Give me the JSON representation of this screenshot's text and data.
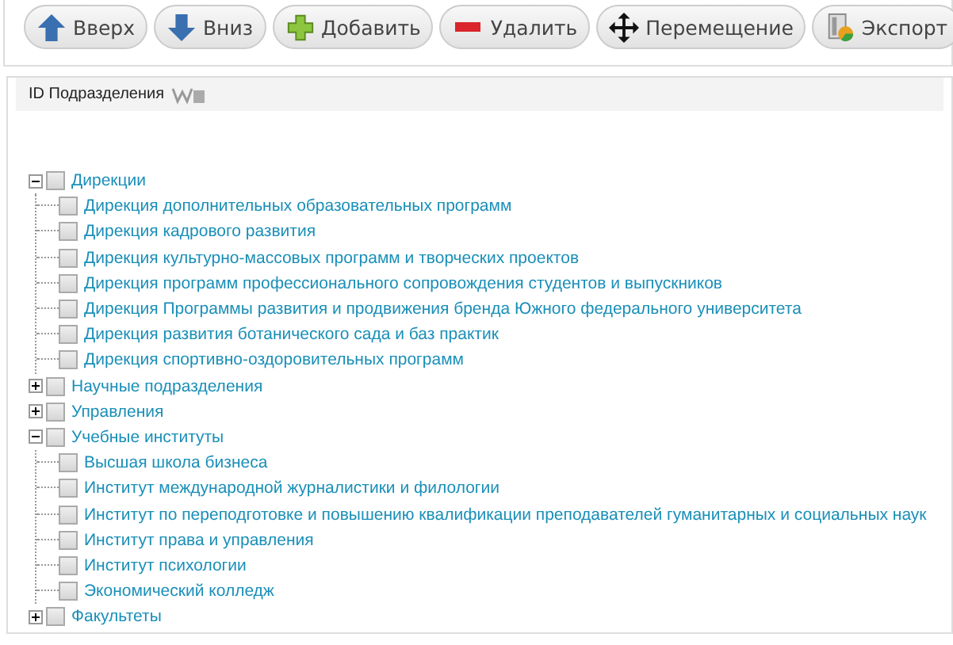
{
  "toolbar": {
    "buttons": [
      {
        "label": "Вверх",
        "kind": "up"
      },
      {
        "label": "Вниз",
        "kind": "down"
      },
      {
        "label": "Добавить",
        "kind": "add"
      },
      {
        "label": "Удалить",
        "kind": "delete"
      },
      {
        "label": "Перемещение",
        "kind": "move"
      },
      {
        "label": "Экспорт",
        "kind": "export"
      }
    ]
  },
  "tree_panel": {
    "header": "ID Подразделения",
    "nodes": [
      {
        "label": "Дирекции",
        "expanded": true,
        "checked": false,
        "children": [
          {
            "label": "Дирекция дополнительных образовательных программ",
            "checked": false
          },
          {
            "label": "Дирекция кадрового развития",
            "checked": false
          },
          {
            "label": "Дирекция культурно-массовых программ и творческих проектов",
            "checked": false
          },
          {
            "label": "Дирекция программ профессионального сопровождения студентов и выпускников",
            "checked": false
          },
          {
            "label": "Дирекция Программы развития и продвижения бренда Южного федерального университета",
            "checked": false
          },
          {
            "label": "Дирекция развития ботанического сада и баз практик",
            "checked": false
          },
          {
            "label": "Дирекция спортивно-оздоровительных программ",
            "checked": false
          }
        ]
      },
      {
        "label": "Научные подразделения",
        "expanded": false,
        "checked": false
      },
      {
        "label": "Управления",
        "expanded": false,
        "checked": false
      },
      {
        "label": "Учебные институты",
        "expanded": true,
        "checked": false,
        "children": [
          {
            "label": "Высшая школа бизнеса",
            "checked": false
          },
          {
            "label": "Институт международной журналистики и филологии",
            "checked": false
          },
          {
            "label": "Институт по переподготовке и повышению квалификации преподавателей гуманитарных и социальных наук",
            "checked": false
          },
          {
            "label": "Институт права и управления",
            "checked": false
          },
          {
            "label": "Институт психологии",
            "checked": false
          },
          {
            "label": "Экономический колледж",
            "checked": false
          }
        ]
      },
      {
        "label": "Факультеты",
        "expanded": false,
        "checked": false
      }
    ]
  }
}
